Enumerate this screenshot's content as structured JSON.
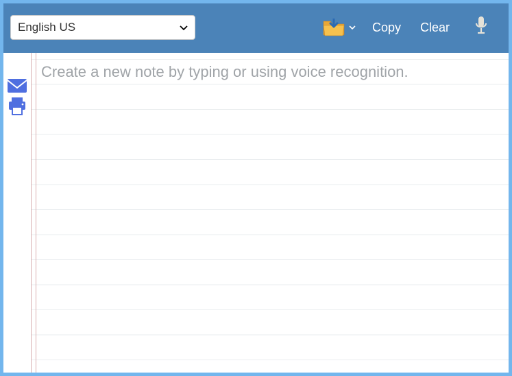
{
  "toolbar": {
    "language_selected": "English US",
    "copy_label": "Copy",
    "clear_label": "Clear"
  },
  "editor": {
    "placeholder": "Create a new note by typing or using voice recognition.",
    "value": ""
  },
  "icons": {
    "download": "download-folder-icon",
    "microphone": "microphone-icon",
    "email": "email-icon",
    "print": "print-icon"
  },
  "colors": {
    "toolbar_bg": "#4b83b8",
    "frame_bg": "#73b6ed",
    "side_icon": "#4f6fe0",
    "margin_line": "#d9aeb0",
    "rule_line": "#eaedef"
  }
}
